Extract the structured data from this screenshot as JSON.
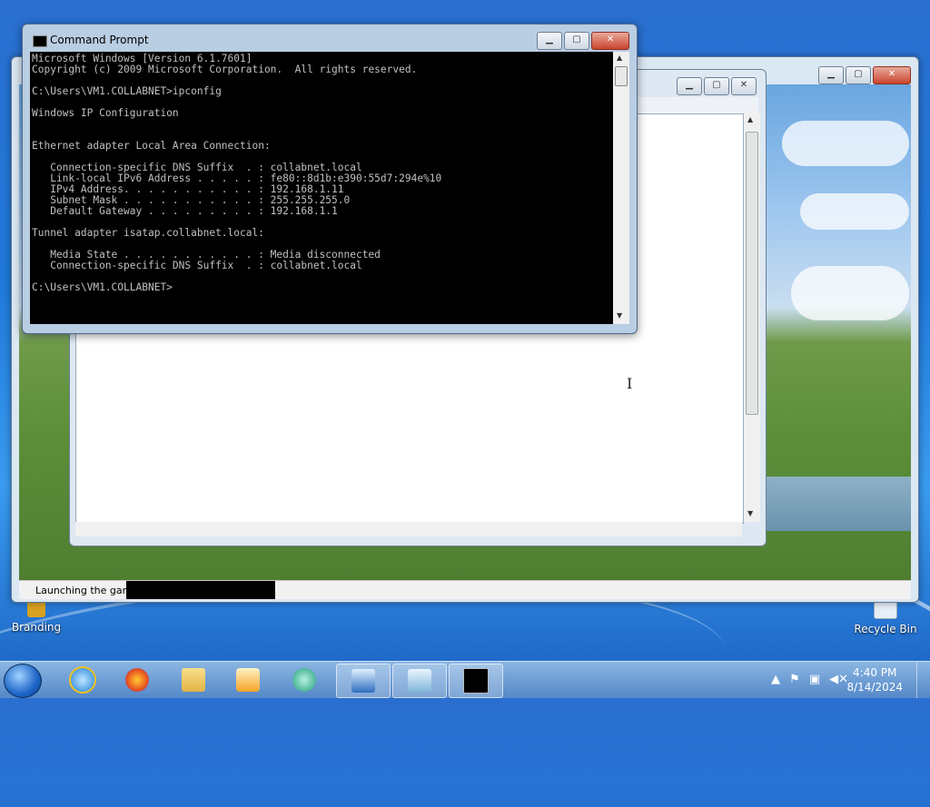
{
  "desktop": {
    "icons": [
      {
        "label": "Branding"
      },
      {
        "label": "Recycle Bin"
      }
    ]
  },
  "launcher": {
    "status_text": "Launching the game...",
    "progress_fraction": 0.0
  },
  "cmd": {
    "title": "Command Prompt",
    "lines": [
      "Microsoft Windows [Version 6.1.7601]",
      "Copyright (c) 2009 Microsoft Corporation.  All rights reserved.",
      "",
      "C:\\Users\\VM1.COLLABNET>ipconfig",
      "",
      "Windows IP Configuration",
      "",
      "",
      "Ethernet adapter Local Area Connection:",
      "",
      "   Connection-specific DNS Suffix  . : collabnet.local",
      "   Link-local IPv6 Address . . . . . : fe80::8d1b:e390:55d7:294e%10",
      "   IPv4 Address. . . . . . . . . . . : 192.168.1.11",
      "   Subnet Mask . . . . . . . . . . . : 255.255.255.0",
      "   Default Gateway . . . . . . . . . : 192.168.1.1",
      "",
      "Tunnel adapter isatap.collabnet.local:",
      "",
      "   Media State . . . . . . . . . . . : Media disconnected",
      "   Connection-specific DNS Suffix  . : collabnet.local",
      "",
      "C:\\Users\\VM1.COLLABNET>"
    ]
  },
  "window_buttons": {
    "minimize": "▁",
    "maximize": "▢",
    "close": "✕"
  },
  "taskbar": {
    "items": [
      "internet-explorer",
      "firefox",
      "file-explorer",
      "media-player",
      "chat-app",
      "remote-desktop",
      "notepad",
      "command-prompt"
    ],
    "time": "4:40 PM",
    "date": "8/14/2024"
  },
  "colors": {
    "console_bg": "#000000",
    "console_fg": "#c0c0c0"
  }
}
